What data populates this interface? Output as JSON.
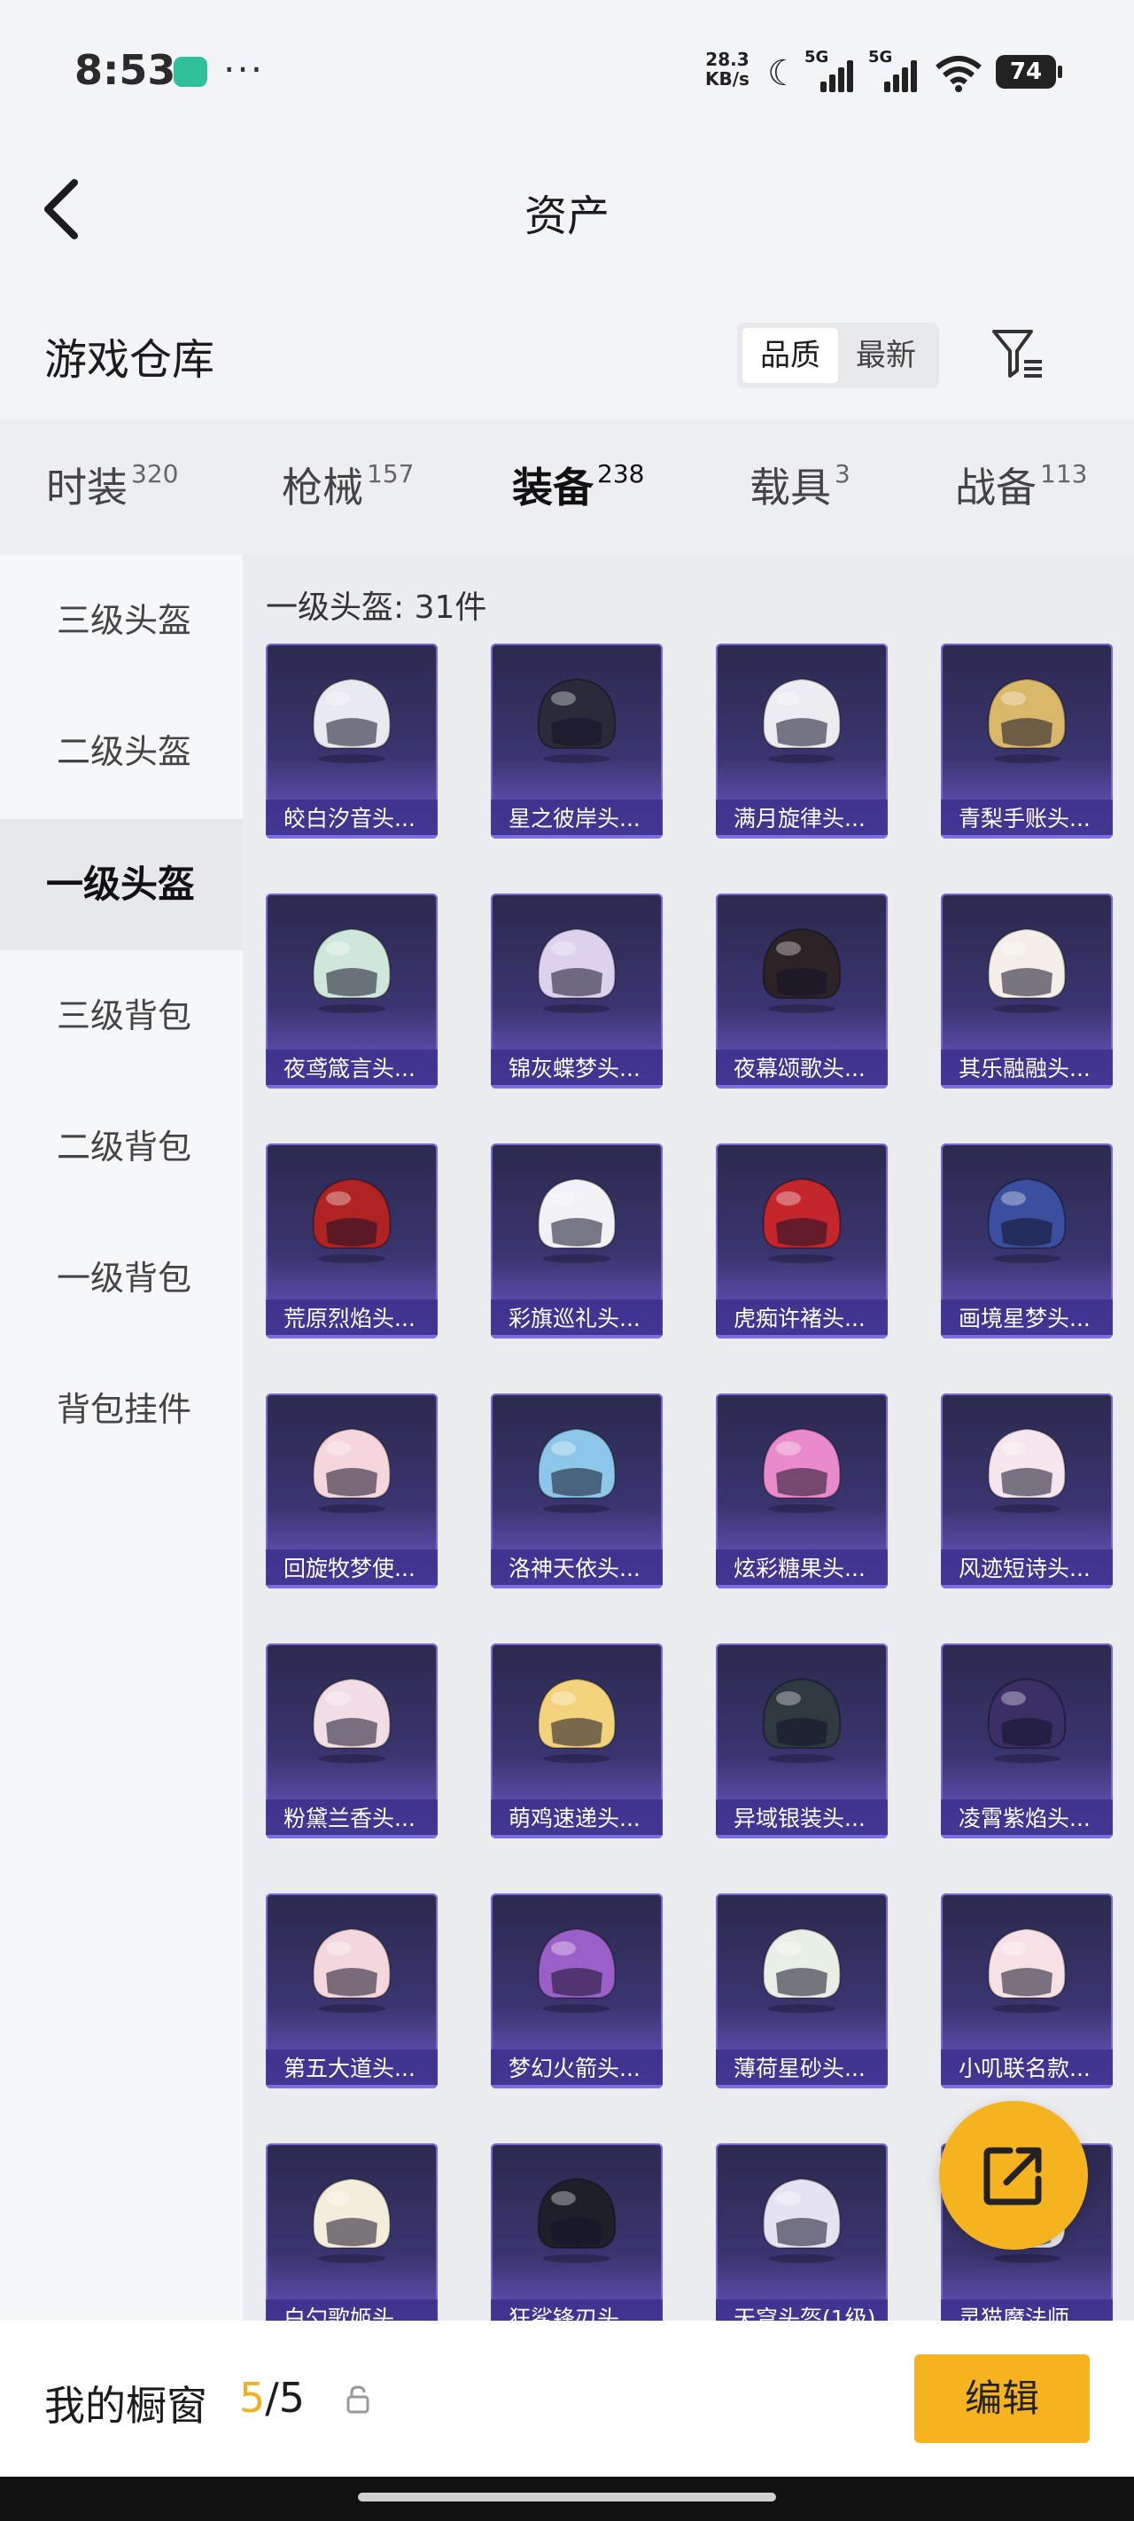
{
  "status_bar": {
    "time": "8:53",
    "net_speed_value": "28.3",
    "net_speed_unit": "KB/s",
    "signal1": "5G",
    "signal2": "5G",
    "battery": "74"
  },
  "nav": {
    "title": "资产"
  },
  "warehouse": {
    "title": "游戏仓库",
    "sort_options": [
      "品质",
      "最新"
    ],
    "sort_selected": "品质"
  },
  "categories": [
    {
      "label": "时装",
      "count": "320"
    },
    {
      "label": "枪械",
      "count": "157"
    },
    {
      "label": "装备",
      "count": "238"
    },
    {
      "label": "载具",
      "count": "3"
    },
    {
      "label": "战备",
      "count": "113"
    }
  ],
  "active_category": "装备",
  "sidebar": {
    "items": [
      "三级头盔",
      "二级头盔",
      "一级头盔",
      "三级背包",
      "二级背包",
      "一级背包",
      "背包挂件"
    ],
    "active": "一级头盔"
  },
  "main": {
    "count_label": "一级头盔: 31件",
    "items": [
      {
        "name": "皎白汐音头...",
        "color": "#e9e9f0"
      },
      {
        "name": "星之彼岸头...",
        "color": "#2a2a3a"
      },
      {
        "name": "满月旋律头...",
        "color": "#ececf1"
      },
      {
        "name": "青梨手账头...",
        "color": "#d9b869"
      },
      {
        "name": "夜鸢箴言头...",
        "color": "#cfe7da"
      },
      {
        "name": "锦灰蝶梦头...",
        "color": "#dcd2ee"
      },
      {
        "name": "夜幕颂歌头...",
        "color": "#2b2326"
      },
      {
        "name": "其乐融融头...",
        "color": "#f3eee8"
      },
      {
        "name": "荒原烈焰头...",
        "color": "#b02323"
      },
      {
        "name": "彩旗巡礼头...",
        "color": "#f2f2f6"
      },
      {
        "name": "虎痴许褚头...",
        "color": "#c4262c"
      },
      {
        "name": "画境星梦头...",
        "color": "#3a4f9f"
      },
      {
        "name": "回旋牧梦使...",
        "color": "#f5d6dc"
      },
      {
        "name": "洛神天依头...",
        "color": "#8cc6e8"
      },
      {
        "name": "炫彩糖果头...",
        "color": "#e98acb"
      },
      {
        "name": "风迹短诗头...",
        "color": "#f4e6ec"
      },
      {
        "name": "粉黛兰香头...",
        "color": "#f0dde6"
      },
      {
        "name": "萌鸡速递头...",
        "color": "#f2d27a"
      },
      {
        "name": "异域银装头...",
        "color": "#2e3a40"
      },
      {
        "name": "凌霄紫焰头...",
        "color": "#3b2f66"
      },
      {
        "name": "第五大道头...",
        "color": "#f4d7dc"
      },
      {
        "name": "梦幻火箭头...",
        "color": "#9a5fc8"
      },
      {
        "name": "薄荷星砂头...",
        "color": "#e8efe6"
      },
      {
        "name": "小叽联名款...",
        "color": "#f6e2e6"
      },
      {
        "name": "白勺歌姬头...",
        "color": "#f3eddc"
      },
      {
        "name": "狂鲨锋刃头...",
        "color": "#1d2029"
      },
      {
        "name": "天穹头盔(1级)",
        "color": "#e5e2f2"
      },
      {
        "name": "灵猫魔法师...",
        "color": "#f1f1f5"
      }
    ]
  },
  "bottom_bar": {
    "label": "我的橱窗",
    "current": "5",
    "total": "/5",
    "edit_label": "编辑"
  },
  "colors": {
    "accent": "#f5b320",
    "card_bg": "#3a3570"
  }
}
